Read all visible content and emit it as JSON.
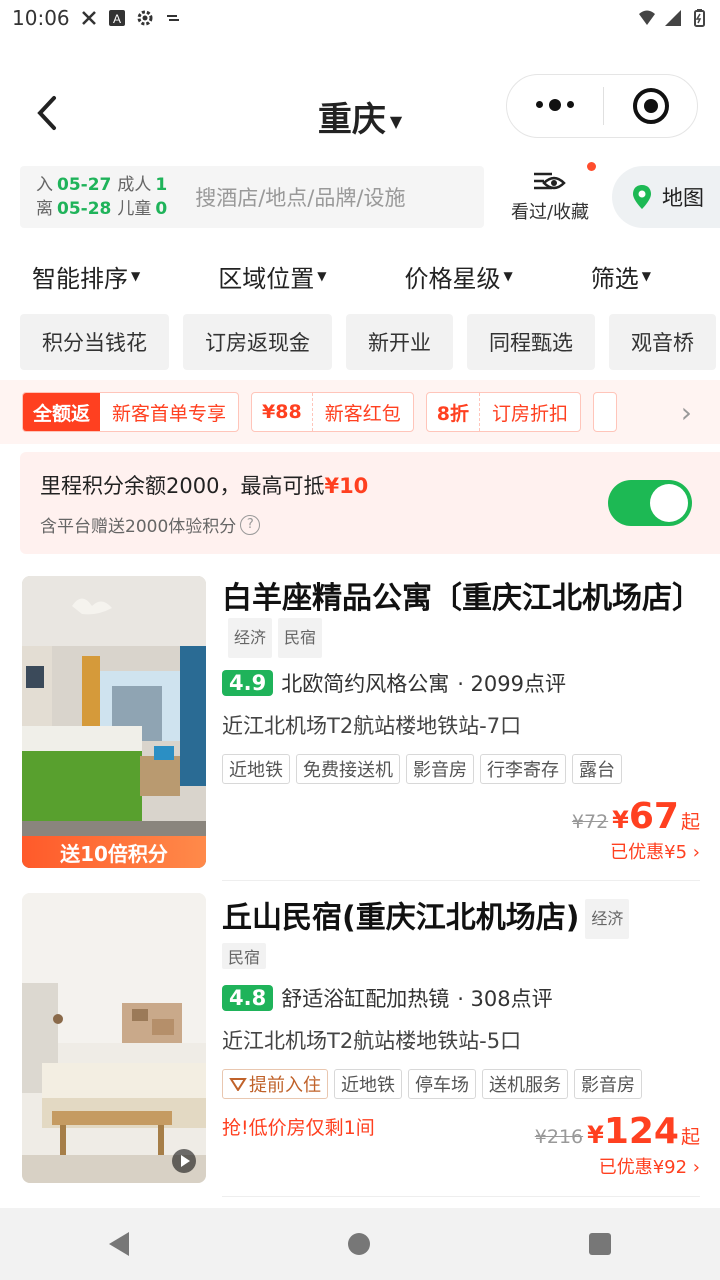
{
  "status": {
    "time": "10:06"
  },
  "header": {
    "city": "重庆"
  },
  "search": {
    "checkin_label": "入",
    "checkin": "05-27",
    "checkout_label": "离",
    "checkout": "05-28",
    "adults_label": "成人",
    "adults": "1",
    "children_label": "儿童",
    "children": "0",
    "placeholder": "搜酒店/地点/品牌/设施",
    "fav_label": "看过/收藏",
    "map_label": "地图"
  },
  "sort": [
    "智能排序",
    "区域位置",
    "价格星级",
    "筛选"
  ],
  "quick_tags": [
    "积分当钱花",
    "订房返现金",
    "新开业",
    "同程甄选",
    "观音桥"
  ],
  "promos": [
    {
      "badge": "全额返",
      "text": "新客首单专享"
    },
    {
      "badge": "¥88",
      "text": "新客红包"
    },
    {
      "badge": "8折",
      "text": "订房折扣"
    }
  ],
  "points": {
    "line1": "里程积分余额2000，最高可抵",
    "amount": "¥10",
    "line2": "含平台赠送2000体验积分"
  },
  "hotels": [
    {
      "title": "白羊座精品公寓〔重庆江北机场店〕",
      "kinds": [
        "经济",
        "民宿"
      ],
      "score": "4.9",
      "slogan": "北欧简约风格公寓",
      "reviews": "· 2099点评",
      "location": "近江北机场T2航站楼地铁站-7口",
      "features": [
        "近地铁",
        "免费接送机",
        "影音房",
        "行李寄存",
        "露台"
      ],
      "original_price": "¥72",
      "price": "67",
      "qi": "起",
      "saved": "已优惠¥5",
      "thumb_banner": "送10倍积分"
    },
    {
      "title": "丘山民宿(重庆江北机场店)",
      "kinds": [
        "经济",
        "民宿"
      ],
      "score": "4.8",
      "slogan": "舒适浴缸配加热镜",
      "reviews": "· 308点评",
      "location": "近江北机场T2航站楼地铁站-5口",
      "early": "提前入住",
      "features": [
        "近地铁",
        "停车场",
        "送机服务",
        "影音房"
      ],
      "urgent": "抢!低价房仅剩1间",
      "original_price": "¥216",
      "price": "124",
      "qi": "起",
      "saved": "已优惠¥92"
    }
  ]
}
